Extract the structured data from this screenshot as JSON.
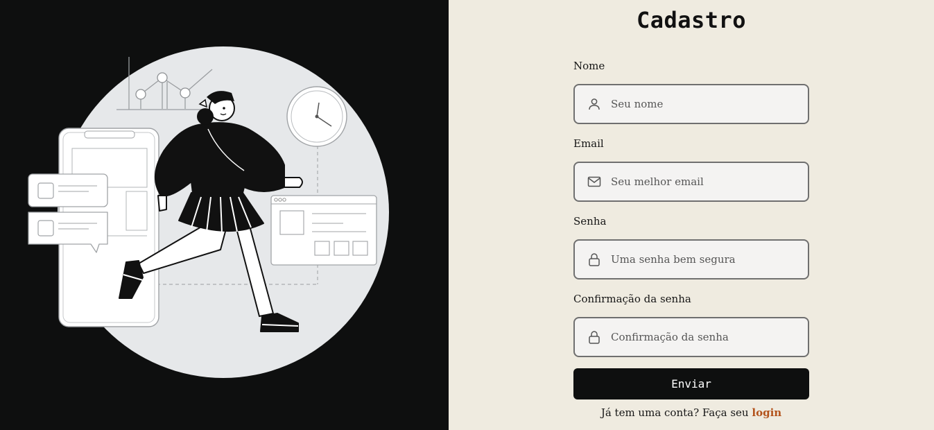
{
  "form": {
    "title": "Cadastro",
    "fields": [
      {
        "label": "Nome",
        "placeholder": "Seu nome",
        "icon": "user-icon"
      },
      {
        "label": "Email",
        "placeholder": "Seu melhor email",
        "icon": "mail-icon"
      },
      {
        "label": "Senha",
        "placeholder": "Uma senha bem segura",
        "icon": "lock-icon"
      },
      {
        "label": "Confirmação da senha",
        "placeholder": "Confirmação da senha",
        "icon": "lock-icon"
      }
    ],
    "submit_label": "Enviar",
    "login_prompt": "Já tem uma conta? Faça seu",
    "login_link": "login"
  },
  "colors": {
    "left_background": "#0e0f0f",
    "right_background": "#efebe0",
    "field_background": "#f4f3f2",
    "field_border": "#6f6f6f",
    "button_background": "#0e0f0f",
    "link_color": "#b3531c",
    "illustration_circle": "#e6e8ea"
  }
}
